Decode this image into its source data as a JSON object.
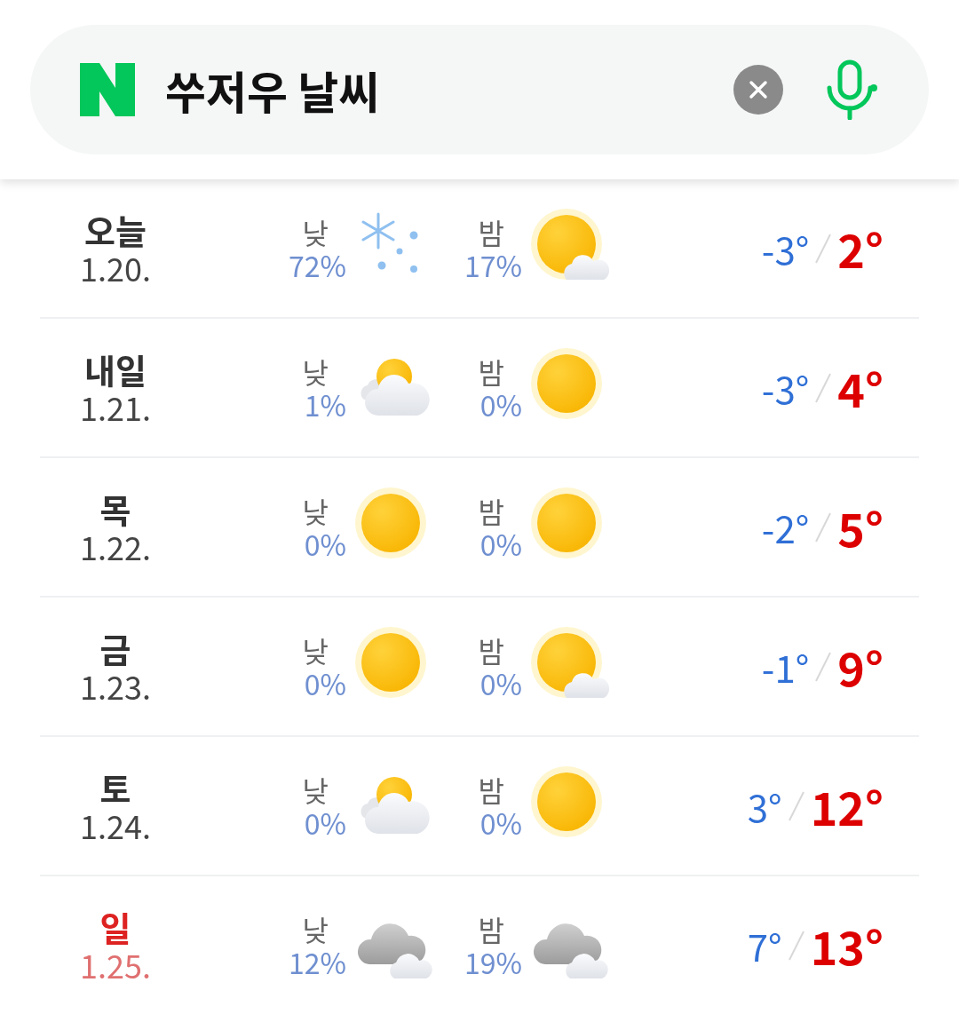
{
  "search": {
    "value": "쑤저우 날씨"
  },
  "days": [
    {
      "day": "오늘",
      "date": "1.20.",
      "holiday": false,
      "am": {
        "label": "낮",
        "precip": "72%",
        "kind": "snow"
      },
      "pm": {
        "label": "밤",
        "precip": "17%",
        "kind": "sun_cloud"
      },
      "low": "-3°",
      "high": "2°"
    },
    {
      "day": "내일",
      "date": "1.21.",
      "holiday": false,
      "am": {
        "label": "낮",
        "precip": "1%",
        "kind": "partly_cloudy"
      },
      "pm": {
        "label": "밤",
        "precip": "0%",
        "kind": "sun"
      },
      "low": "-3°",
      "high": "4°"
    },
    {
      "day": "목",
      "date": "1.22.",
      "holiday": false,
      "am": {
        "label": "낮",
        "precip": "0%",
        "kind": "sun"
      },
      "pm": {
        "label": "밤",
        "precip": "0%",
        "kind": "sun"
      },
      "low": "-2°",
      "high": "5°"
    },
    {
      "day": "금",
      "date": "1.23.",
      "holiday": false,
      "am": {
        "label": "낮",
        "precip": "0%",
        "kind": "sun"
      },
      "pm": {
        "label": "밤",
        "precip": "0%",
        "kind": "sun_cloud"
      },
      "low": "-1°",
      "high": "9°"
    },
    {
      "day": "토",
      "date": "1.24.",
      "holiday": false,
      "am": {
        "label": "낮",
        "precip": "0%",
        "kind": "partly_cloudy"
      },
      "pm": {
        "label": "밤",
        "precip": "0%",
        "kind": "sun"
      },
      "low": "3°",
      "high": "12°"
    },
    {
      "day": "일",
      "date": "1.25.",
      "holiday": true,
      "am": {
        "label": "낮",
        "precip": "12%",
        "kind": "cloudy"
      },
      "pm": {
        "label": "밤",
        "precip": "19%",
        "kind": "cloudy"
      },
      "low": "7°",
      "high": "13°"
    }
  ]
}
